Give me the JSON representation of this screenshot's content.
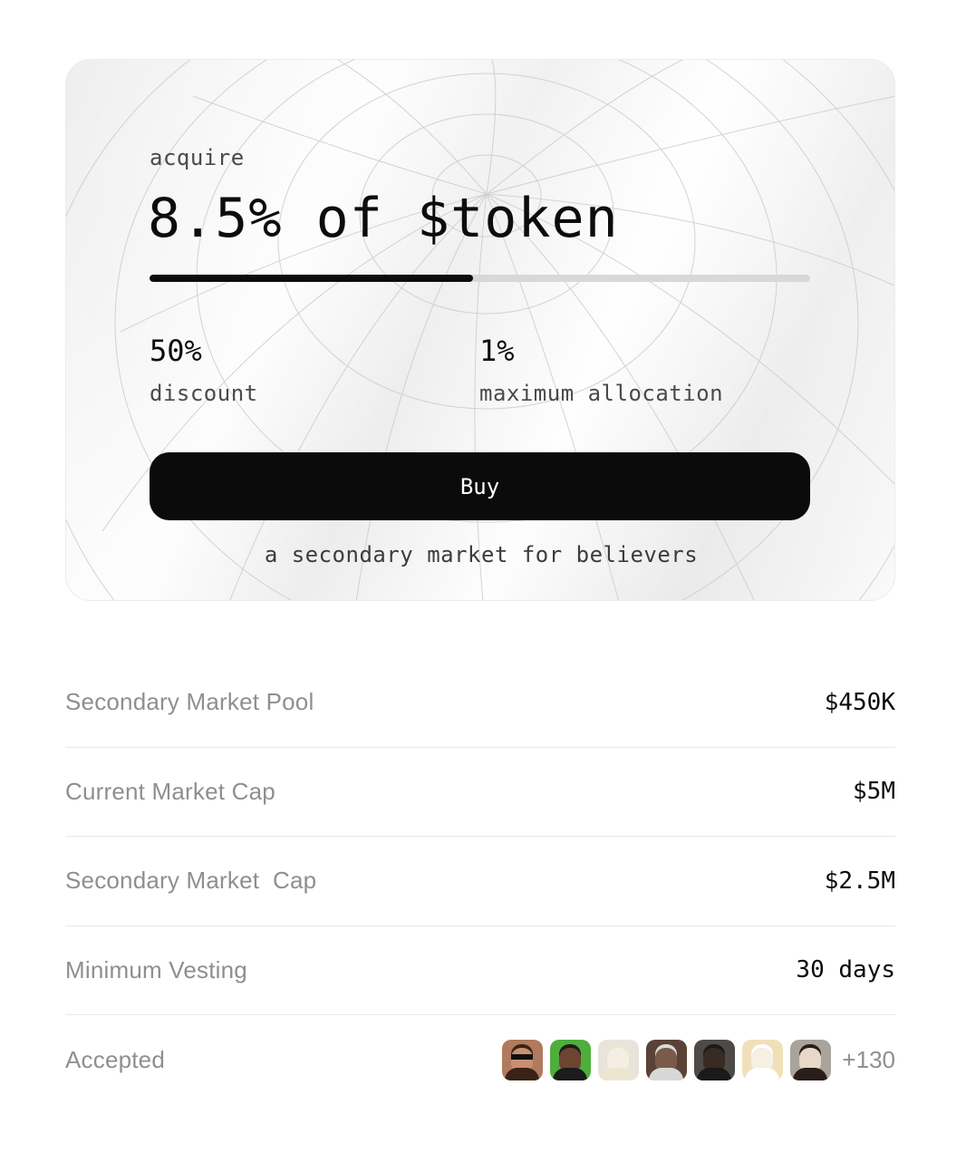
{
  "card": {
    "eyebrow": "acquire",
    "headline": "8.5% of $token",
    "progress": 0.49,
    "stats": [
      {
        "value": "50%",
        "label": "discount"
      },
      {
        "value": "1%",
        "label": "maximum allocation"
      }
    ],
    "buy_label": "Buy",
    "tagline": "a secondary market for believers"
  },
  "info": {
    "rows": [
      {
        "label": "Secondary Market Pool",
        "value": "$450K"
      },
      {
        "label": "Current Market Cap",
        "value": "$5M"
      },
      {
        "label": "Secondary Market  Cap",
        "value": "$2.5M"
      },
      {
        "label": "Minimum Vesting",
        "value": "30 days"
      }
    ],
    "accepted_label": "Accepted",
    "accepted_more": "+130",
    "avatar_colors": [
      "#b07a5e",
      "#4fae3c",
      "#e8e4dc",
      "#5a4236",
      "#4e4a48",
      "#f0e0b8",
      "#a8a49c"
    ]
  }
}
